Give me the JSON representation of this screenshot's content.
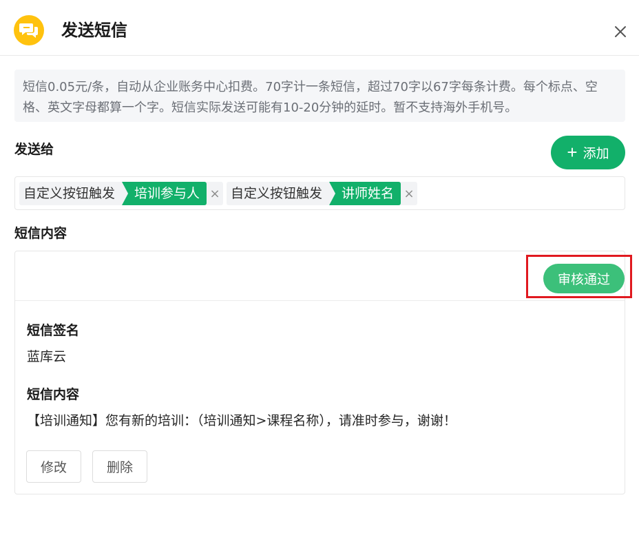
{
  "dialog": {
    "title": "发送短信",
    "logo_icon": "chat-bubbles-icon",
    "close_icon": "close-icon"
  },
  "notice": {
    "text": "短信0.05元/条，自动从企业账务中心扣费。70字计一条短信，超过70字以67字每条计费。每个标点、空格、英文字母都算一个字。短信实际发送可能有10-20分钟的延时。暂不支持海外手机号。"
  },
  "recipients": {
    "label": "发送给",
    "add_button": {
      "icon": "+",
      "label": "添加"
    },
    "tags": [
      {
        "prefix": "自定义按钮触发",
        "value": "培训参与人",
        "remove": "×"
      },
      {
        "prefix": "自定义按钮触发",
        "value": "讲师姓名",
        "remove": "×"
      }
    ]
  },
  "content": {
    "label": "短信内容",
    "approve_button": "审核通过",
    "signature_label": "短信签名",
    "signature_value": "蓝库云",
    "body_label": "短信内容",
    "body_value": "【培训通知】您有新的培训：（培训通知>课程名称），请准时参与，谢谢！",
    "edit_button": "修改",
    "delete_button": "删除"
  },
  "colors": {
    "accent_green": "#12b06a",
    "approve_green": "#3cc07a",
    "logo_yellow": "#ffc20e",
    "highlight_red": "#e0191f"
  }
}
